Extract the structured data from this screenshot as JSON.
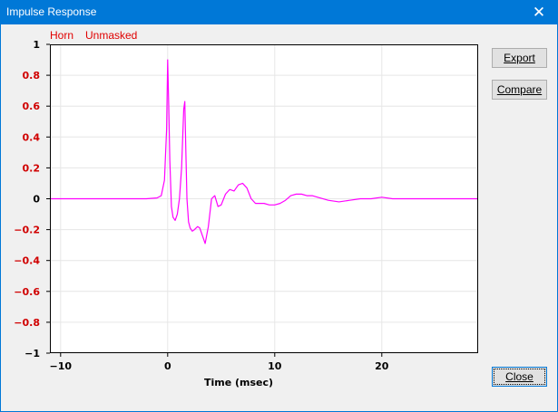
{
  "window": {
    "title": "Impulse Response",
    "close_glyph": "✕",
    "title_bar_color": "#0078d7"
  },
  "legend": {
    "horn_label": "Horn",
    "unmasked_label": "Unmasked",
    "color": "#e00000"
  },
  "buttons": {
    "export_label": "Export",
    "compare_label": "Compare",
    "close_label": "Close"
  },
  "chart_data": {
    "type": "line",
    "title": "",
    "xlabel": "Time (msec)",
    "ylabel": "",
    "xlim": [
      -11,
      29
    ],
    "ylim": [
      -1,
      1
    ],
    "grid": true,
    "x_ticks": [
      -10,
      0,
      10,
      20
    ],
    "x_tick_labels": [
      "−10",
      "0",
      "10",
      "20"
    ],
    "y_ticks": [
      1,
      0.8,
      0.6,
      0.4,
      0.2,
      0,
      -0.2,
      -0.4,
      -0.6,
      -0.8,
      -1
    ],
    "y_tick_labels": [
      "1",
      "0.8",
      "0.6",
      "0.4",
      "0.2",
      "0",
      "−0.2",
      "−0.4",
      "−0.6",
      "−0.8",
      "−1"
    ],
    "y_tick_colors": [
      "#000000",
      "#d00000",
      "#d00000",
      "#d00000",
      "#d00000",
      "#000000",
      "#d00000",
      "#d00000",
      "#d00000",
      "#d00000",
      "#000000"
    ],
    "series": [
      {
        "color": "#ff00ff",
        "x": [
          -11,
          -8,
          -5,
          -2,
          -1,
          -0.6,
          -0.3,
          -0.1,
          0,
          0.1,
          0.2,
          0.35,
          0.5,
          0.7,
          0.9,
          1.1,
          1.3,
          1.5,
          1.6,
          1.7,
          1.8,
          1.95,
          2.1,
          2.3,
          2.5,
          2.8,
          3.0,
          3.2,
          3.5,
          3.8,
          4.1,
          4.4,
          4.7,
          5.0,
          5.4,
          5.8,
          6.2,
          6.6,
          7.0,
          7.4,
          7.8,
          8.2,
          8.6,
          9.0,
          9.5,
          10,
          10.5,
          11,
          11.5,
          12,
          12.5,
          13,
          13.5,
          14,
          15,
          16,
          17,
          18,
          19,
          20,
          21,
          22,
          23,
          24,
          25,
          26,
          27,
          28,
          29
        ],
        "y": [
          0,
          0,
          0,
          0,
          0.005,
          0.02,
          0.12,
          0.45,
          0.9,
          0.6,
          0.25,
          -0.05,
          -0.12,
          -0.14,
          -0.1,
          0.0,
          0.2,
          0.58,
          0.63,
          0.3,
          0.0,
          -0.15,
          -0.19,
          -0.21,
          -0.2,
          -0.18,
          -0.19,
          -0.23,
          -0.29,
          -0.18,
          0.0,
          0.02,
          -0.05,
          -0.04,
          0.03,
          0.06,
          0.05,
          0.09,
          0.1,
          0.07,
          0.0,
          -0.03,
          -0.03,
          -0.03,
          -0.04,
          -0.04,
          -0.03,
          -0.01,
          0.02,
          0.03,
          0.03,
          0.02,
          0.02,
          0.01,
          -0.01,
          -0.02,
          -0.01,
          0.0,
          0.0,
          0.01,
          0.0,
          0.0,
          0.0,
          0.0,
          0.0,
          0.0,
          0.0,
          0.0,
          0.0
        ]
      }
    ]
  }
}
